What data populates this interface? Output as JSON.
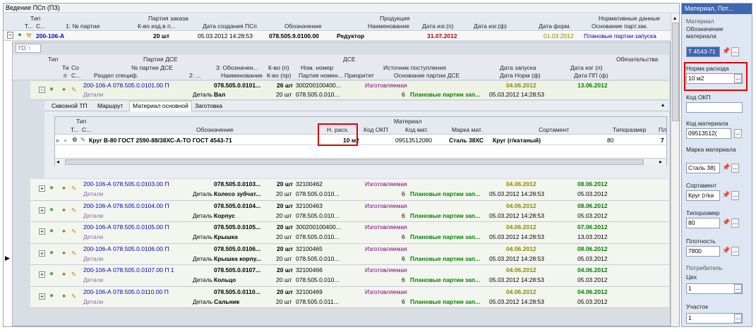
{
  "window_title": "Ведение ПСп (ПЗ)",
  "top_header": {
    "groups": [
      "Тип",
      "Партия заказа",
      "Продукция",
      "Нормативные данные"
    ],
    "cols": [
      "Т...",
      "С...",
      "1: № партии",
      "К-во изд.в п...",
      "Дата создания ПСп",
      "Обозначение",
      "Наименование",
      "Дата изг.(п)",
      "Дата изг.(ф)",
      "Дата форм.",
      "Основание парт.зак."
    ]
  },
  "order_row": {
    "party": "200-106-А",
    "qty": "20 шт",
    "created": "05.03.2012 14:28:53",
    "designation": "078.505.9.0100.00",
    "name": "Редуктор",
    "date_plan": "31.07.2012",
    "date_form": "01.03.2012",
    "basis": "Плановые партии запуска"
  },
  "group_label": "ГО",
  "sub_header": {
    "groups": [
      "Тип",
      "Партия ДСЕ",
      "ДСЕ",
      "Обязательства"
    ],
    "row1": [
      "Ти",
      "Со",
      "№ партии ДСЕ",
      "3: Обозначен...",
      "К-во (п)",
      "Ном. номер",
      "Источник поступления",
      "Дата запуска",
      "Дата изг (п)"
    ],
    "row2": [
      "п",
      "С...",
      "Раздел специф.",
      "2: ...",
      "Наименование",
      "К-во (пр)",
      "Партия номен...",
      "Приоритет",
      "Основание партии ДСЕ",
      "Дата Норм (ф)",
      "Дата ПП (ф)"
    ]
  },
  "tabs": [
    "Сквозной ТП",
    "Маршрут",
    "Материал основной",
    "Заготовка"
  ],
  "material_header": {
    "group_type": "Тип",
    "group_material": "Материал",
    "cols": [
      "Т...",
      "С...",
      "Обозначение",
      "Н. расх.",
      "Код ОКП",
      "Код мат.",
      "Марка мат.",
      "Сортамент",
      "Типоразмер",
      "Пл"
    ]
  },
  "material_row": {
    "designation": "Круг В-80 ГОСТ 2590-88/38ХС-А-ТО ГОСТ 4543-71",
    "norm": "10 м2",
    "okp": "",
    "code": "09513512080",
    "grade": "Сталь 38ХС",
    "sortament": "Круг (г/катаный)",
    "size": "80",
    "pl": "7"
  },
  "parts": [
    {
      "party": "200-106-А 078.505.0.0101.00 П",
      "section": "Детали",
      "kind": "Деталь",
      "designation": "078.505.0.0101...",
      "name": "Вал",
      "qty": "26 шт",
      "qty2": "20 шт",
      "nom": "3002001004​00...",
      "nom2": "078.505.0.010...",
      "source": "Изготовляемая",
      "priority": "6",
      "basis": "Плановые партии зап...",
      "start": "04.06.2012",
      "norm_date": "05.03.2012 14:28:53",
      "make_date": "13.06.2012",
      "pp_date": ""
    },
    {
      "party": "200-106-А 078.505.0.0103.00 П",
      "section": "Детали",
      "kind": "Деталь",
      "designation": "078.505.0.0103...",
      "name": "Колесо зубчат...",
      "qty": "20 шт",
      "qty2": "20 шт",
      "nom": "32100462",
      "nom2": "078.505.0.010...",
      "source": "Изготовляемая",
      "priority": "6",
      "basis": "Плановые партии зап...",
      "start": "04.06.2012",
      "norm_date": "05.03.2012 14:28:53",
      "make_date": "08.06.2012",
      "pp_date": "05.03.2012"
    },
    {
      "party": "200-106-А 078.505.0.0104.00 П",
      "section": "Детали",
      "kind": "Деталь",
      "designation": "078.505.0.0104...",
      "name": "Корпус",
      "qty": "20 шт",
      "qty2": "20 шт",
      "nom": "32100463",
      "nom2": "078.505.0.010...",
      "source": "Изготовляемая",
      "priority": "6",
      "basis": "Плановые партии зап...",
      "start": "04.06.2012",
      "norm_date": "05.03.2012 14:28:53",
      "make_date": "08.06.2012",
      "pp_date": "05.03.2012"
    },
    {
      "party": "200-106-А 078.505.0.0105.00 П",
      "section": "Детали",
      "kind": "Деталь",
      "designation": "078.505.0.0105...",
      "name": "Крышка",
      "qty": "20 шт",
      "qty2": "20 шт",
      "nom": "3002001004​00...",
      "nom2": "078.505.0.010...",
      "source": "Изготовляемая",
      "priority": "6",
      "basis": "Плановые партии зап...",
      "start": "04.06.2012",
      "norm_date": "05.03.2012 14:28:53",
      "make_date": "07.06.2012",
      "pp_date": "13.03.2012"
    },
    {
      "party": "200-106-А 078.505.0.0106.00 П",
      "section": "Детали",
      "kind": "Деталь",
      "designation": "078.505.0.0106...",
      "name": "Крышка корпу...",
      "qty": "20 шт",
      "qty2": "20 шт",
      "nom": "32100465",
      "nom2": "078.505.0.010...",
      "source": "Изготовляемая",
      "priority": "6",
      "basis": "Плановые партии зап...",
      "start": "04.06.2012",
      "norm_date": "05.03.2012 14:28:53",
      "make_date": "08.06.2012",
      "pp_date": "05.03.2012"
    },
    {
      "party": "200-106-А 078.505.0.0107.00 П 1",
      "section": "Детали",
      "kind": "Деталь",
      "designation": "078.505.0.0107...",
      "name": "Кольцо",
      "qty": "20 шт",
      "qty2": "20 шт",
      "nom": "32100466",
      "nom2": "078.505.0.010...",
      "source": "Изготовляемая",
      "priority": "6",
      "basis": "Плановые партии зап...",
      "start": "04.06.2012",
      "norm_date": "05.03.2012 14:28:53",
      "make_date": "04.06.2012",
      "pp_date": "05.03.2012"
    },
    {
      "party": "200-106-А 078.505.0.0110.00 П",
      "section": "Детали",
      "kind": "Деталь",
      "designation": "078.505.0.0110...",
      "name": "Сальник",
      "qty": "20 шт",
      "qty2": "20 шт",
      "nom": "32100469",
      "nom2": "078.505.0.011...",
      "source": "Изготовляемая",
      "priority": "6",
      "basis": "Плановые партии зап...",
      "start": "04.06.2012",
      "norm_date": "05.03.2012 14:28:53",
      "make_date": "04.06.2012",
      "pp_date": "05.03.2012"
    }
  ],
  "sidebar": {
    "title": "Материал, Пот...",
    "group_material": "Материал",
    "designation_label": "Обозначение материала",
    "designation_value": "Т 4543-71",
    "norm_label": "Норма расхода",
    "norm_value": "10 м2",
    "okp_label": "Код ОКП",
    "okp_value": "",
    "code_label": "Код материала",
    "code_value": "09513512(",
    "grade_label": "Марка материала",
    "grade_value": "Сталь 38)",
    "sortament_label": "Сортамент",
    "sortament_value": "Круг (г/ка",
    "size_label": "Типоразмер",
    "size_value": "80",
    "density_label": "Плотность",
    "density_value": "7800",
    "group_consumer": "Потребитель",
    "shop_label": "Цех",
    "shop_value": "1",
    "section_label": "Участок",
    "section_value": "1"
  },
  "colors": {
    "highlight": "#e00000",
    "link": "#0000c8",
    "date_olive": "#8a8a00",
    "date_green": "#008000",
    "accent": "#3f66b0"
  }
}
